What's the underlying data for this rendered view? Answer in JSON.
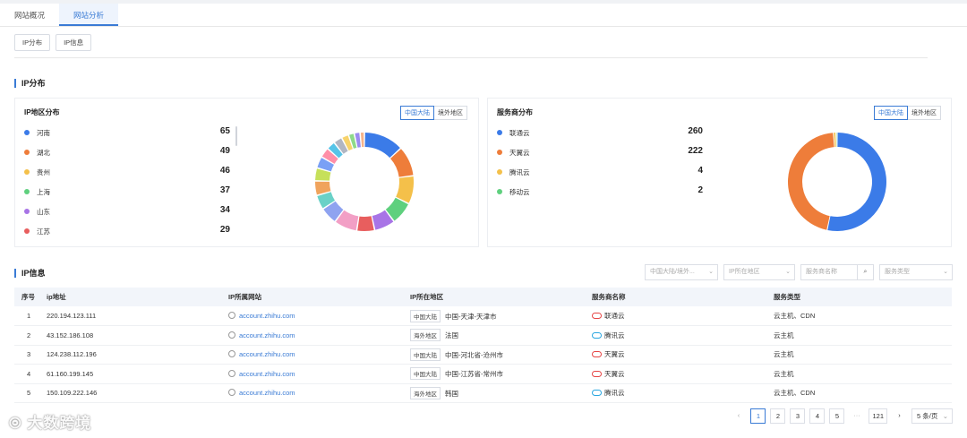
{
  "tabs": [
    "网站概况",
    "网站分析"
  ],
  "subtabs": [
    "IP分布",
    "IP信息"
  ],
  "section_ip_dist": "IP分布",
  "section_ip_info": "IP信息",
  "region_card": {
    "title": "IP地区分布",
    "toggle": [
      "中国大陆",
      "境外地区"
    ],
    "items": [
      {
        "name": "河南",
        "value": "65",
        "color": "#3b7be8"
      },
      {
        "name": "湖北",
        "value": "49",
        "color": "#ee7d3a"
      },
      {
        "name": "贵州",
        "value": "46",
        "color": "#f4c04a"
      },
      {
        "name": "上海",
        "value": "37",
        "color": "#5fd07e"
      },
      {
        "name": "山东",
        "value": "34",
        "color": "#a874e6"
      },
      {
        "name": "江苏",
        "value": "29",
        "color": "#e85e5e"
      }
    ]
  },
  "provider_card": {
    "title": "服务商分布",
    "toggle": [
      "中国大陆",
      "境外地区"
    ],
    "items": [
      {
        "name": "联通云",
        "value": "260",
        "color": "#3b7be8"
      },
      {
        "name": "天翼云",
        "value": "222",
        "color": "#ee7d3a"
      },
      {
        "name": "腾讯云",
        "value": "4",
        "color": "#f4c04a"
      },
      {
        "name": "移动云",
        "value": "2",
        "color": "#5fd07e"
      }
    ]
  },
  "filters": {
    "region_type": "中国大陆/境外...",
    "ip_region": "IP所在地区",
    "provider_name": "服务商名称",
    "service_type": "服务类型"
  },
  "table": {
    "headers": [
      "序号",
      "ip地址",
      "IP所属网站",
      "IP所在地区",
      "服务商名称",
      "服务类型"
    ],
    "rows": [
      {
        "no": "1",
        "ip": "220.194.123.111",
        "site": "account.zhihu.com",
        "tag": "中国大陆",
        "region": "中国-天津-天津市",
        "provider": "联通云",
        "cloud": "red",
        "type": "云主机、CDN"
      },
      {
        "no": "2",
        "ip": "43.152.186.108",
        "site": "account.zhihu.com",
        "tag": "海外地区",
        "region": "法国",
        "provider": "腾讯云",
        "cloud": "blue",
        "type": "云主机"
      },
      {
        "no": "3",
        "ip": "124.238.112.196",
        "site": "account.zhihu.com",
        "tag": "中国大陆",
        "region": "中国-河北省-沧州市",
        "provider": "天翼云",
        "cloud": "red",
        "type": "云主机"
      },
      {
        "no": "4",
        "ip": "61.160.199.145",
        "site": "account.zhihu.com",
        "tag": "中国大陆",
        "region": "中国-江苏省-常州市",
        "provider": "天翼云",
        "cloud": "red",
        "type": "云主机"
      },
      {
        "no": "5",
        "ip": "150.109.222.146",
        "site": "account.zhihu.com",
        "tag": "海外地区",
        "region": "韩国",
        "provider": "腾讯云",
        "cloud": "blue",
        "type": "云主机、CDN"
      }
    ]
  },
  "pagination": {
    "pages": [
      "1",
      "2",
      "3",
      "4",
      "5"
    ],
    "ellipsis": "···",
    "last": "121",
    "page_size": "5 条/页",
    "current": "1"
  },
  "watermark": "大数跨境"
}
